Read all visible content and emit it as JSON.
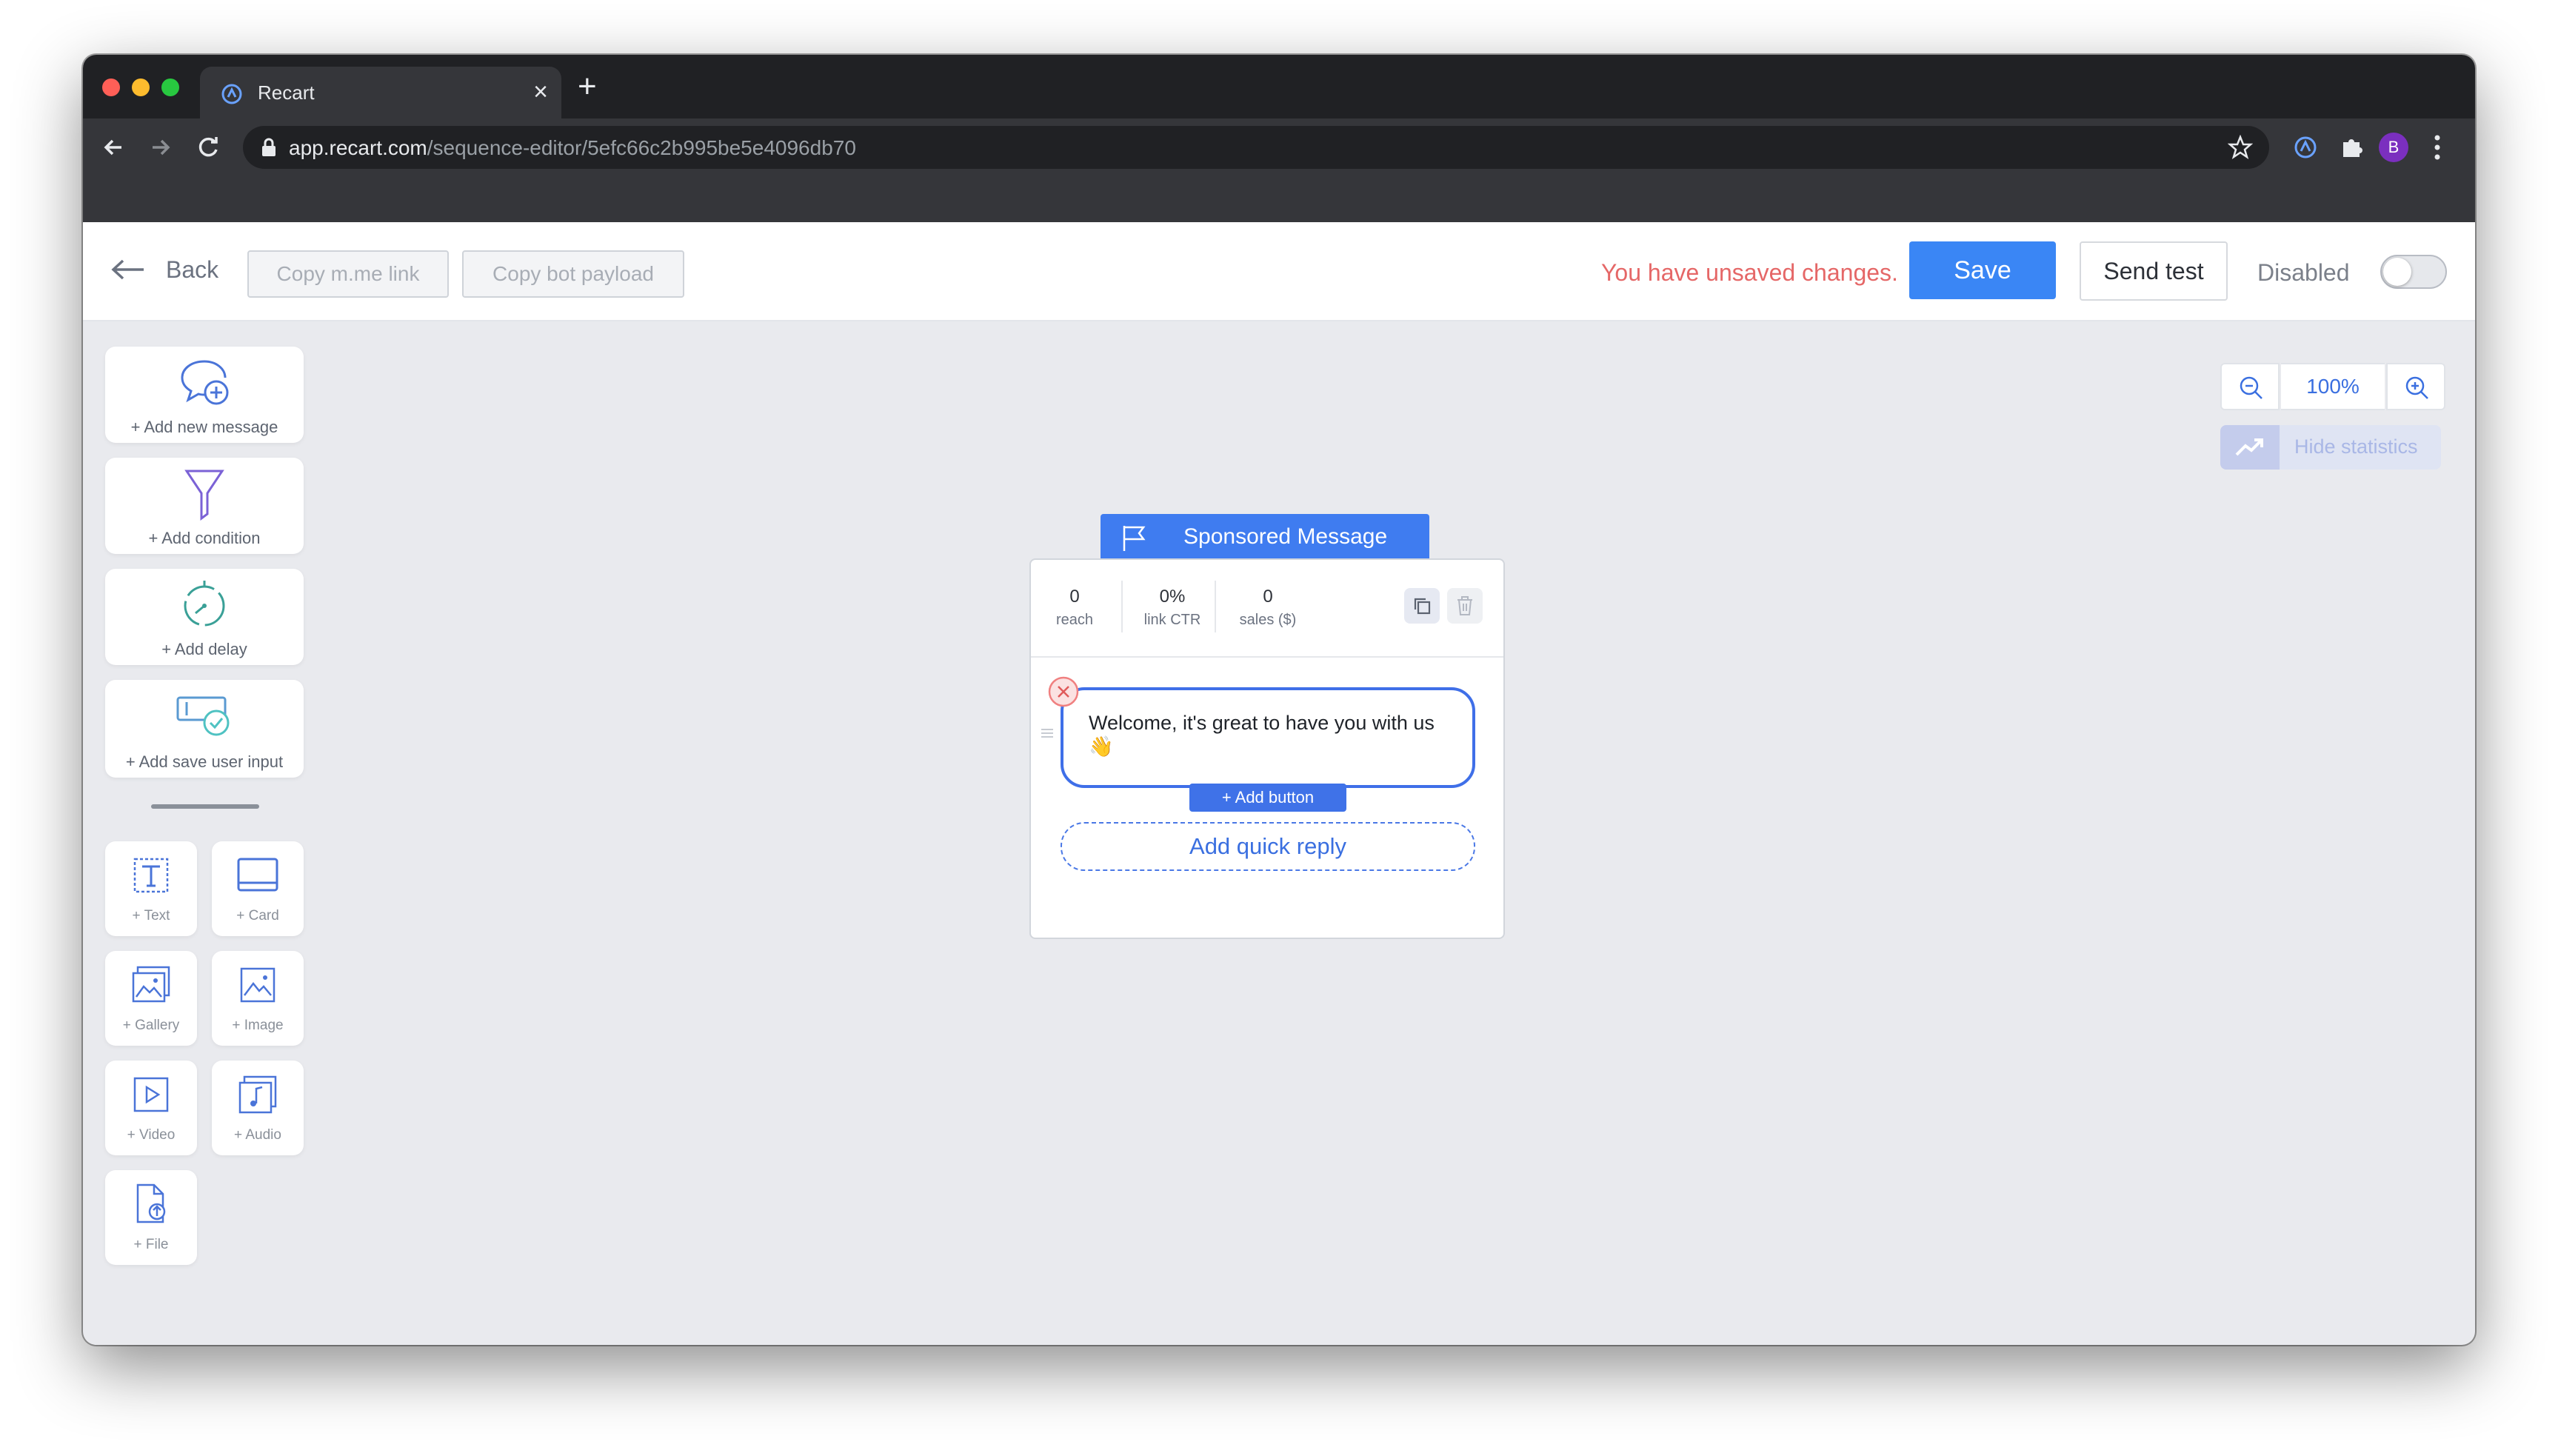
{
  "browser": {
    "tab_title": "Recart",
    "url_host": "app.recart.com",
    "url_path": "/sequence-editor/5efc66c2b995be5e4096db70",
    "profile_initial": "B"
  },
  "header": {
    "back_label": "Back",
    "copy_link_label": "Copy m.me link",
    "copy_payload_label": "Copy bot payload",
    "unsaved_text": "You have unsaved changes.",
    "save_label": "Save",
    "send_test_label": "Send test",
    "status_label": "Disabled",
    "enabled": false
  },
  "palette": {
    "actions": [
      {
        "label": "+ Add new message",
        "icon": "chat-plus-icon"
      },
      {
        "label": "+ Add condition",
        "icon": "funnel-icon"
      },
      {
        "label": "+ Add delay",
        "icon": "timer-icon"
      },
      {
        "label": "+ Add save user input",
        "icon": "input-check-icon"
      }
    ],
    "elements": [
      {
        "label": "+ Text",
        "icon": "text-icon"
      },
      {
        "label": "+ Card",
        "icon": "card-icon"
      },
      {
        "label": "+ Gallery",
        "icon": "gallery-icon"
      },
      {
        "label": "+ Image",
        "icon": "image-icon"
      },
      {
        "label": "+ Video",
        "icon": "video-icon"
      },
      {
        "label": "+ Audio",
        "icon": "audio-icon"
      },
      {
        "label": "+ File",
        "icon": "file-upload-icon"
      }
    ]
  },
  "zoom": {
    "level": "100%"
  },
  "stats_toggle": {
    "label": "Hide statistics"
  },
  "message_card": {
    "title": "Sponsored Message",
    "stats": [
      {
        "value": "0",
        "label": "reach"
      },
      {
        "value": "0%",
        "label": "link CTR"
      },
      {
        "value": "0",
        "label": "sales ($)"
      }
    ],
    "text": "Welcome, it's great to have you with us 👋",
    "add_button_label": "+ Add button",
    "quick_reply_label": "Add quick reply"
  },
  "colors": {
    "accent": "#3a86f5",
    "header_blue": "#3f7cf0",
    "warning": "#e56767",
    "canvas": "#e9eaee"
  }
}
